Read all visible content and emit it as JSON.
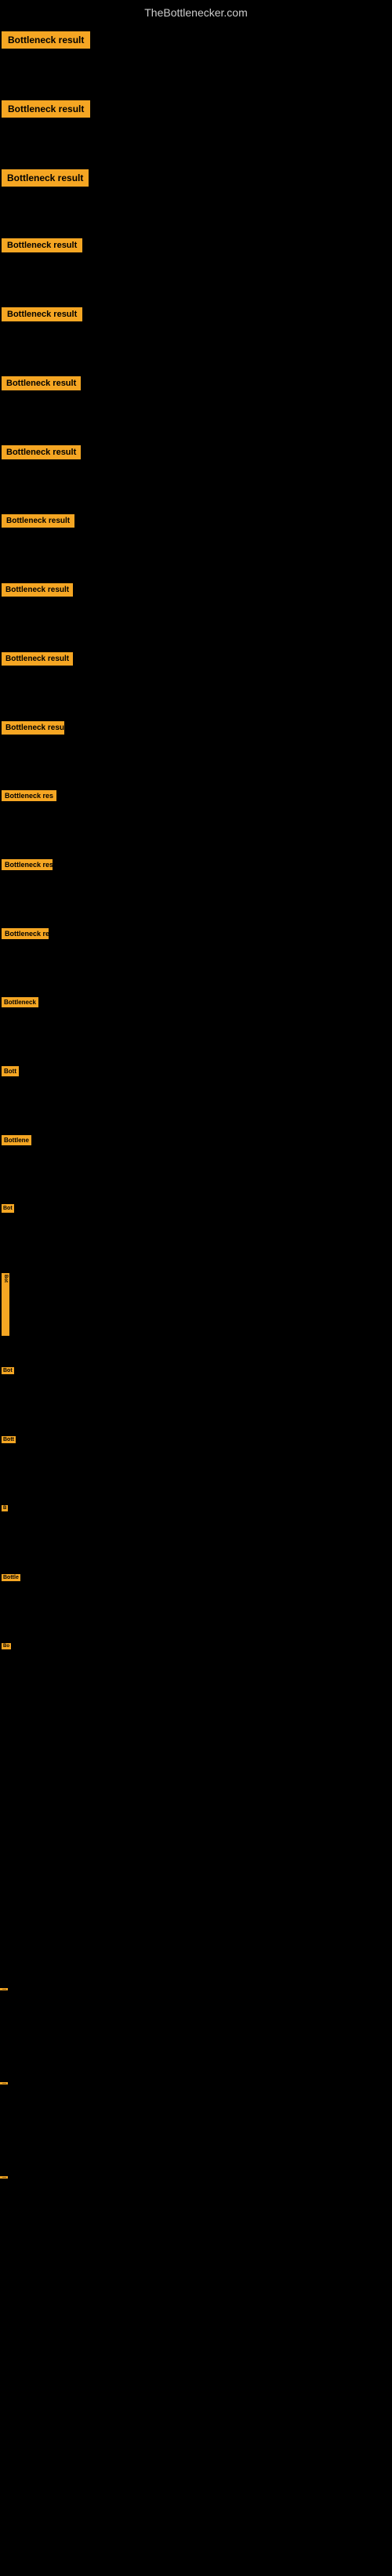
{
  "site": {
    "title": "TheBottlenecker.com"
  },
  "badge_label": "Bottleneck result",
  "items": [
    {
      "id": 1,
      "label": "Bottleneck result"
    },
    {
      "id": 2,
      "label": "Bottleneck result"
    },
    {
      "id": 3,
      "label": "Bottleneck result"
    },
    {
      "id": 4,
      "label": "Bottleneck result"
    },
    {
      "id": 5,
      "label": "Bottleneck result"
    },
    {
      "id": 6,
      "label": "Bottleneck result"
    },
    {
      "id": 7,
      "label": "Bottleneck result"
    },
    {
      "id": 8,
      "label": "Bottleneck result"
    },
    {
      "id": 9,
      "label": "Bottleneck result"
    },
    {
      "id": 10,
      "label": "Bottleneck result"
    },
    {
      "id": 11,
      "label": "Bottleneck resu"
    },
    {
      "id": 12,
      "label": "Bottleneck res"
    },
    {
      "id": 13,
      "label": "Bottleneck res"
    },
    {
      "id": 14,
      "label": "Bottleneck res"
    },
    {
      "id": 15,
      "label": "Bottleneck"
    },
    {
      "id": 16,
      "label": "Bott"
    },
    {
      "id": 17,
      "label": "Bottlene"
    },
    {
      "id": 18,
      "label": "Bot"
    },
    {
      "id": 19,
      "label": "Bot"
    },
    {
      "id": 20,
      "label": "Bot"
    },
    {
      "id": 21,
      "label": "Bott"
    },
    {
      "id": 22,
      "label": "B"
    },
    {
      "id": 23,
      "label": "Bottle"
    },
    {
      "id": 24,
      "label": "Bo"
    }
  ],
  "small_items": [
    {
      "id": 1,
      "label": "|"
    },
    {
      "id": 2,
      "label": "|"
    },
    {
      "id": 3,
      "label": "|"
    }
  ]
}
